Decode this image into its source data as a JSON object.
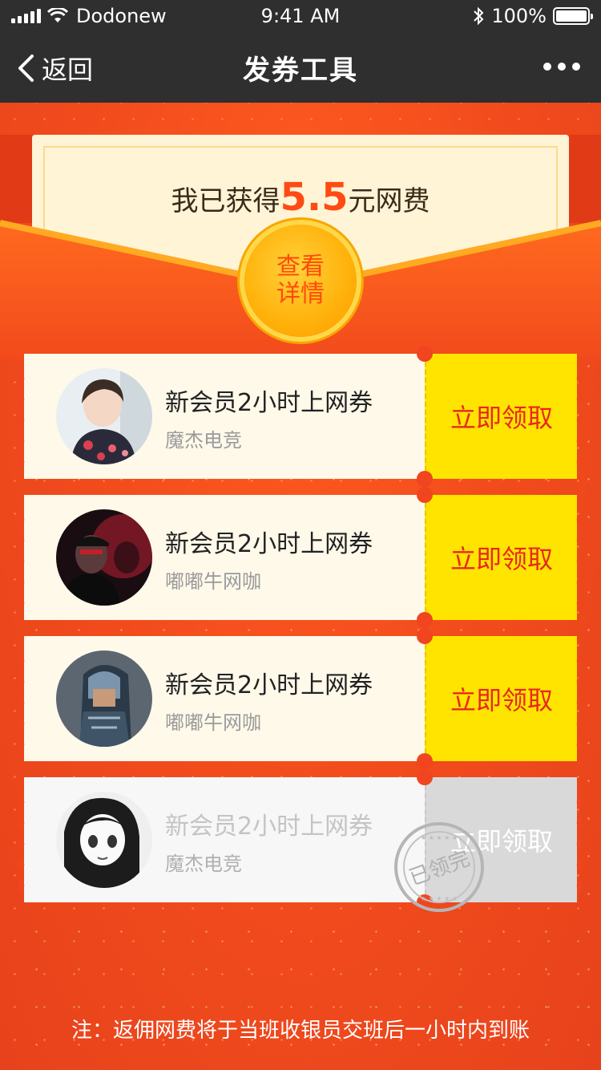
{
  "status_bar": {
    "carrier": "Dodonew",
    "time": "9:41 AM",
    "battery": "100%"
  },
  "nav": {
    "back_label": "返回",
    "title": "发券工具"
  },
  "summary": {
    "prefix": "我已获得",
    "amount": "5.5",
    "suffix": "元网费",
    "details_line1": "查看",
    "details_line2": "详情"
  },
  "coupons": [
    {
      "title": "新会员2小时上网券",
      "shop": "魔杰电竞",
      "action": "立即领取",
      "status": "available"
    },
    {
      "title": "新会员2小时上网券",
      "shop": "嘟嘟牛网咖",
      "action": "立即领取",
      "status": "available"
    },
    {
      "title": "新会员2小时上网券",
      "shop": "嘟嘟牛网咖",
      "action": "立即领取",
      "status": "available"
    },
    {
      "title": "新会员2小时上网券",
      "shop": "魔杰电竞",
      "action": "立即领取",
      "status": "claimed",
      "stamp": "已领完"
    }
  ],
  "footer_note": "注：返佣网费将于当班收银员交班后一小时内到账",
  "colors": {
    "accent_red": "#f0451f",
    "coupon_yellow": "#ffe400",
    "amount_orange": "#ff4a14",
    "topbar": "#2f2f2f"
  }
}
